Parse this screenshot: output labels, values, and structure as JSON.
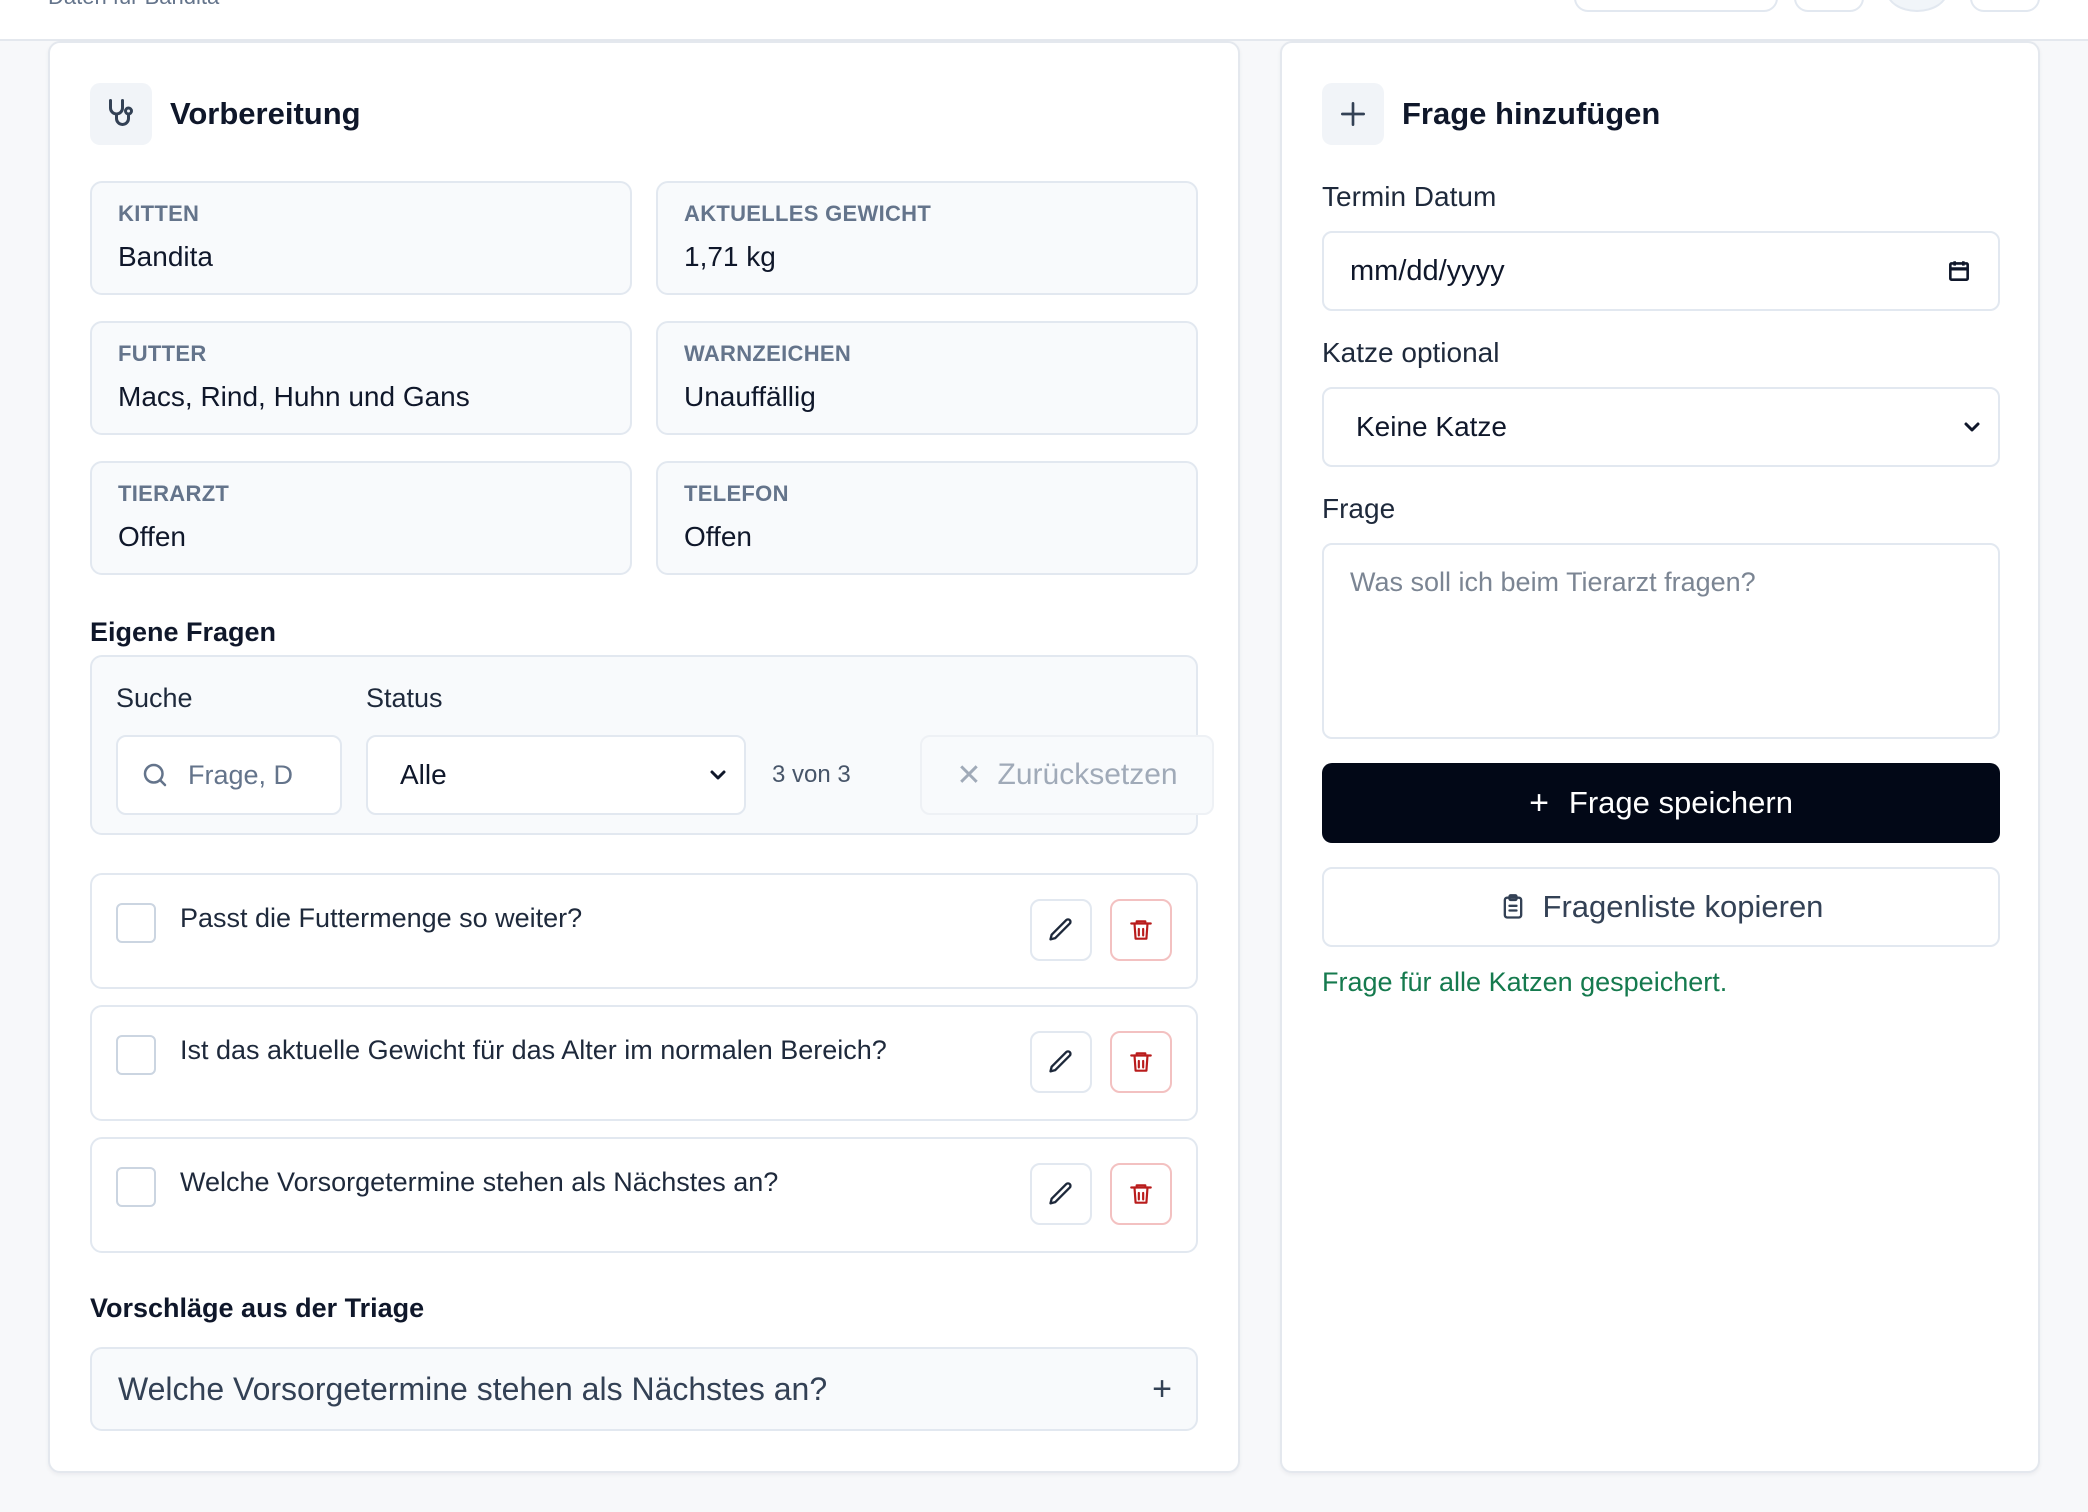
{
  "header": {
    "breadcrumb": "Daten für Bandita"
  },
  "preparation": {
    "title": "Vorbereitung",
    "info": [
      {
        "label": "KITTEN",
        "value": "Bandita"
      },
      {
        "label": "AKTUELLES GEWICHT",
        "value": "1,71 kg"
      },
      {
        "label": "FUTTER",
        "value": "Macs, Rind, Huhn und Gans"
      },
      {
        "label": "WARNZEICHEN",
        "value": "Unauffällig"
      },
      {
        "label": "TIERARZT",
        "value": "Offen"
      },
      {
        "label": "TELEFON",
        "value": "Offen"
      }
    ],
    "own_questions_title": "Eigene Fragen",
    "filter": {
      "search_label": "Suche",
      "search_placeholder": "Frage, D",
      "status_label": "Status",
      "status_value": "Alle",
      "count": "3 von 3",
      "reset_label": "Zurücksetzen"
    },
    "questions": [
      {
        "text": "Passt die Futtermenge so weiter?",
        "checked": false
      },
      {
        "text": "Ist das aktuelle Gewicht für das Alter im normalen Bereich?",
        "checked": false
      },
      {
        "text": "Welche Vorsorgetermine stehen als Nächstes an?",
        "checked": false
      }
    ],
    "suggestions_title": "Vorschläge aus der Triage",
    "suggestions": [
      "Welche Vorsorgetermine stehen als Nächstes an?"
    ]
  },
  "add_question": {
    "title": "Frage hinzufügen",
    "date_label": "Termin Datum",
    "date_placeholder": "mm/dd/yyyy",
    "cat_label": "Katze optional",
    "cat_value": "Keine Katze",
    "question_label": "Frage",
    "question_placeholder": "Was soll ich beim Tierarzt fragen?",
    "save_label": "Frage speichern",
    "copy_label": "Fragenliste kopieren",
    "success_message": "Frage für alle Katzen gespeichert."
  },
  "colors": {
    "primary_button": "#020817",
    "success_text": "#157a4e",
    "delete_icon": "#b91c1c"
  }
}
